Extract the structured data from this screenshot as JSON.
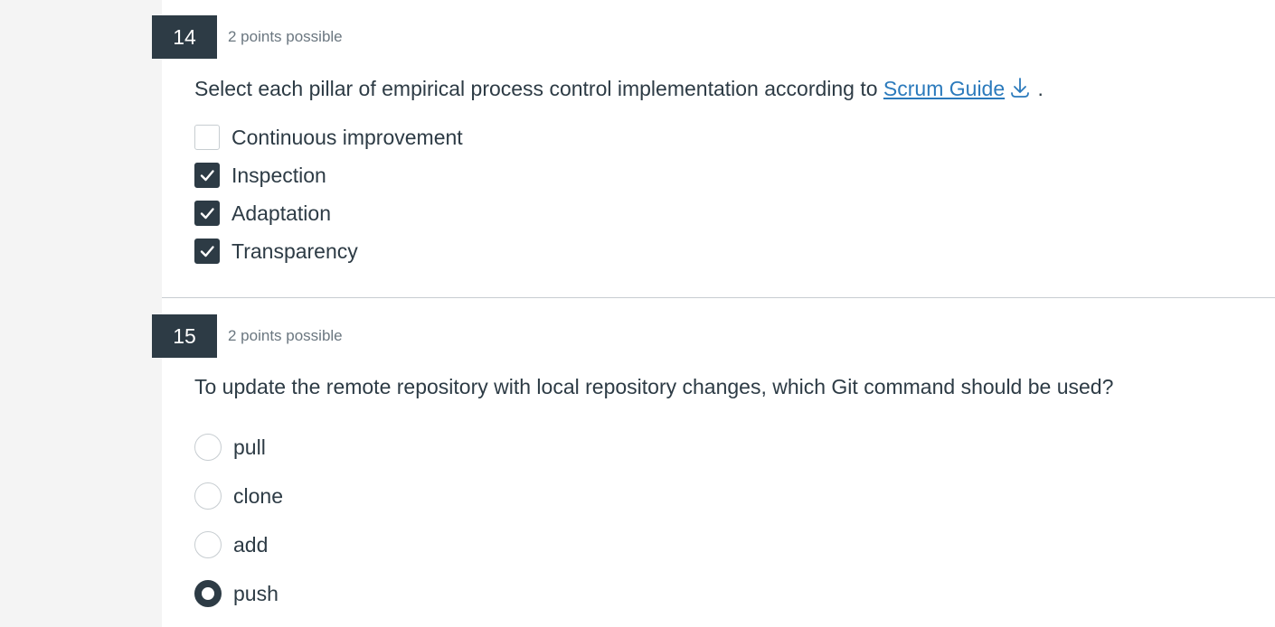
{
  "questions": [
    {
      "number": "14",
      "points": "2 points possible",
      "text_before": "Select each pillar of empirical process control implementation according to",
      "link_text": "Scrum Guide",
      "text_after": ".",
      "link_icon": "download-icon",
      "type": "checkbox",
      "options": [
        {
          "label": "Continuous improvement",
          "checked": false
        },
        {
          "label": "Inspection",
          "checked": true
        },
        {
          "label": "Adaptation",
          "checked": true
        },
        {
          "label": "Transparency",
          "checked": true
        }
      ]
    },
    {
      "number": "15",
      "points": "2 points possible",
      "text": "To update the remote repository with local repository changes, which Git command should be used?",
      "type": "radio",
      "options": [
        {
          "label": "pull",
          "selected": false
        },
        {
          "label": "clone",
          "selected": false
        },
        {
          "label": "add",
          "selected": false
        },
        {
          "label": "push",
          "selected": true
        }
      ]
    }
  ],
  "colors": {
    "header_bg": "#2d3b45",
    "link": "#2b7abc",
    "muted_text": "#6b7780",
    "page_bg": "#f4f4f4"
  }
}
